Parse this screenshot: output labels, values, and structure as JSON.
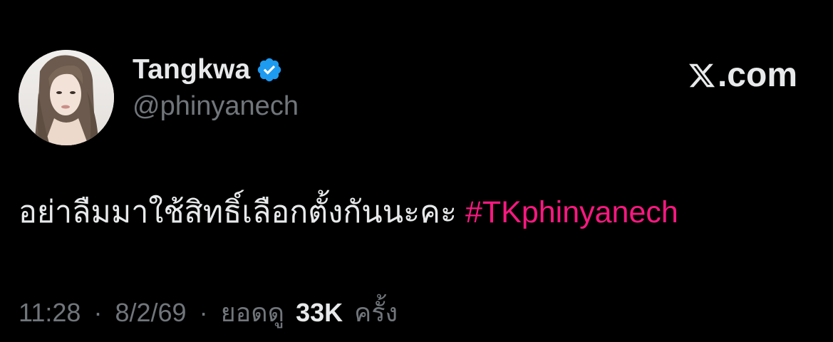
{
  "user": {
    "display_name": "Tangkwa",
    "handle": "@phinyanech",
    "verified": true,
    "avatar_icon": "profile-photo"
  },
  "brand": {
    "domain_text": ".com",
    "logo_icon": "x-logo-icon"
  },
  "tweet": {
    "text": "อย่าลืมมาใช้สิทธิ์เลือกตั้งกันนะคะ",
    "hashtag": "#TKphinyanech"
  },
  "meta": {
    "time": "11:28",
    "separator": "·",
    "date": "8/2/69",
    "views_label": "ยอดดู",
    "views_count": "33K",
    "views_unit": "ครั้ง"
  },
  "colors": {
    "background": "#000000",
    "primary_text": "#e7e9ea",
    "secondary_text": "#71767b",
    "hashtag": "#f91880",
    "verified_badge": "#1d9bf0"
  }
}
